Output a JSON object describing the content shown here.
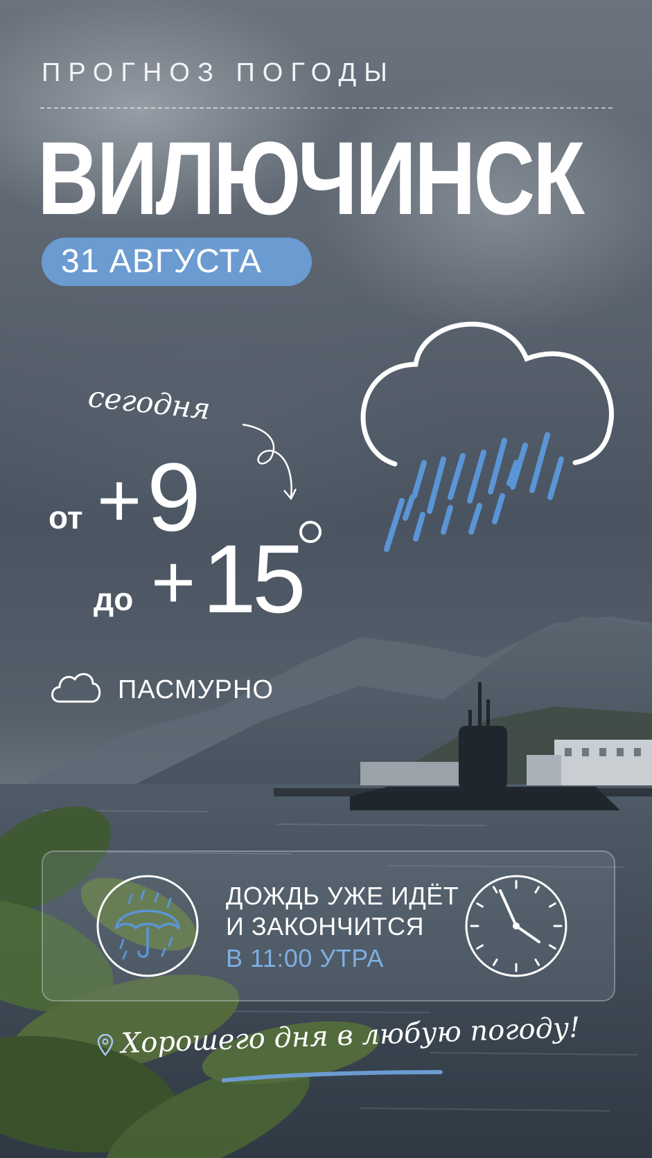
{
  "header": {
    "label": "ПРОГНОЗ ПОГОДЫ",
    "city": "ВИЛЮЧИНСК",
    "date": "31 АВГУСТА"
  },
  "forecast": {
    "today_label": "сегодня",
    "from_word": "от",
    "from_sign": "+",
    "from_value": "9",
    "to_word": "до",
    "to_sign": "+",
    "to_value": "15",
    "condition": "ПАСМУРНО"
  },
  "icons": {
    "big_weather": "rain-cloud-icon",
    "condition": "cloud-icon",
    "card_left": "umbrella-icon",
    "card_right": "clock-icon",
    "footer": "location-pin-icon"
  },
  "rain_card": {
    "line1": "ДОЖДЬ УЖЕ ИДЁТ",
    "line2": "И ЗАКОНЧИТСЯ",
    "line3": "В 11:00 УТРА"
  },
  "footer": {
    "slogan": "Хорошего дня в любую погоду!"
  },
  "colors": {
    "accent_blue": "#6b9bd1",
    "highlight_text": "#7eaee3",
    "rain_drops": "#5b95d6"
  }
}
